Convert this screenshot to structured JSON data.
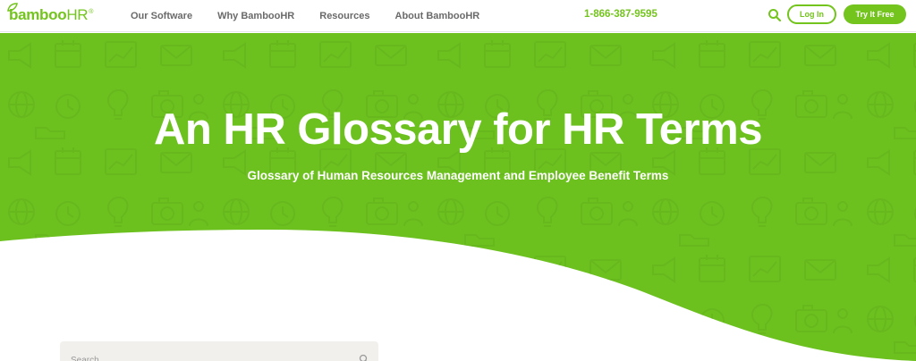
{
  "header": {
    "logo": {
      "bamboo": "bamboo",
      "hr": "HR",
      "reg": "®"
    },
    "nav": [
      {
        "label": "Our Software"
      },
      {
        "label": "Why BambooHR"
      },
      {
        "label": "Resources"
      },
      {
        "label": "About BambooHR"
      }
    ],
    "phone": "1-866-387-9595",
    "login_label": "Log In",
    "try_label": "Try It Free"
  },
  "hero": {
    "title": "An HR Glossary for HR Terms",
    "subtitle": "Glossary of Human Resources Management and Employee Benefit Terms"
  },
  "search": {
    "placeholder": "Search"
  },
  "colors": {
    "brand_green": "#73c41d",
    "hero_green": "#6cc11f",
    "icon_green": "#62b01b",
    "search_bg": "#f2f0ed"
  },
  "icons": [
    "search-icon",
    "leaf-icon",
    "megaphone-icon",
    "calendar-icon",
    "chart-icon",
    "envelope-icon",
    "globe-icon",
    "clock-icon",
    "bulb-icon",
    "camera-icon",
    "users-icon",
    "folder-icon"
  ]
}
